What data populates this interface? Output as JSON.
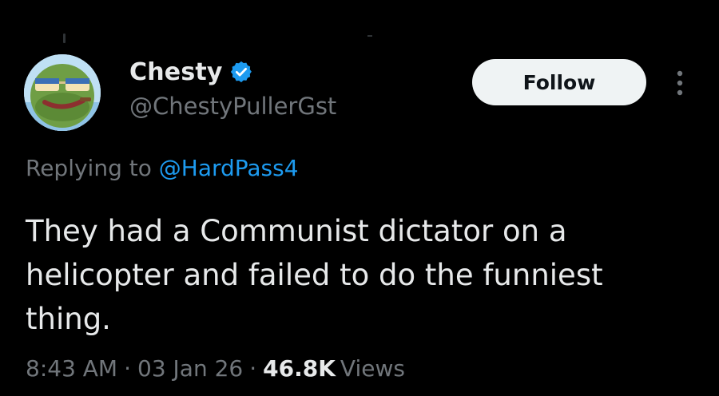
{
  "author": {
    "display_name": "Chesty",
    "handle": "@ChestyPullerGst",
    "verified": true,
    "avatar_icon": "frog-with-sunglasses-avatar"
  },
  "actions": {
    "follow_label": "Follow",
    "more_icon": "more-vertical-icon"
  },
  "reply": {
    "prefix": "Replying to ",
    "mention": "@HardPass4"
  },
  "tweet": {
    "text": "They had a Communist dictator on a\nhelicopter and failed to do the funniest\nthing."
  },
  "meta": {
    "time": "8:43 AM",
    "separator": "·",
    "date": "03 Jan 26",
    "views_count": "46.8K",
    "views_label": "Views"
  },
  "colors": {
    "background": "#000000",
    "primary_text": "#e7e9ea",
    "secondary_text": "#71767b",
    "accent": "#1d9bf0",
    "follow_bg": "#eff3f4"
  }
}
